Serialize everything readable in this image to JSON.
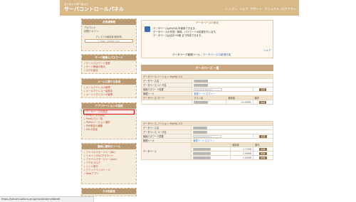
{
  "header": {
    "logo_sub": "さくらインターネット",
    "logo_main": "サーバコントロールパネル",
    "nav": [
      "トップへ",
      "ヘルプ",
      "サポート",
      "マニュアル",
      "ログアウト"
    ]
  },
  "sidebar": {
    "account": {
      "title": "お客様情報",
      "rows": [
        "アカウント",
        "初期ドメイン"
      ],
      "disk_label": "ディスクの使用量(使用率)",
      "disk_value": "1.9GB / 300GB (1%)"
    },
    "server_settings": {
      "title": "サーバ情報とパスワード",
      "items": [
        "サーバパスワード変更",
        "サーバ情報の表示",
        "ログの設定"
      ]
    },
    "mail_settings": {
      "title": "メールに関する設定",
      "items": [
        "メールアドレスの管理",
        "メールアドレス一括設定",
        "メーリングリストの管理"
      ]
    },
    "app_settings": {
      "title": "アプリケーションの設定",
      "items": [
        "データベースの設定",
        "CGIのパスの設定",
        "Perlのパス一覧",
        "PHPのバージョン選択",
        "PHP設定の編集",
        "SSLの設定"
      ]
    },
    "tools": {
      "title": "運用に便利なツール",
      "items": [
        "ファイルマネージャー(ftp)",
        "ドメイン/SSL/アカウント",
        "ファイルマネージャー(root)",
        "アクセスログ",
        "シェル実行",
        "クイックインストール",
        "Webアプリ"
      ]
    },
    "other": {
      "title": "その他設定"
    }
  },
  "main": {
    "top_box": {
      "title": "データベースの設定",
      "body_lines": [
        "データベースはMySQLを使用できます。",
        "データベースの作成・削除、パスワードの変更を行います。",
        "データベースは合計 50個 まで作成できます。"
      ],
      "help": "ヘルプ",
      "link_main": "データベース管理ツール",
      "link_sub": "データベースの新規作成"
    },
    "list_title": "データベース 一覧",
    "db1": {
      "server_row": "データベース バージョン: MySQL 5.5",
      "rows": [
        {
          "label": "データベース名",
          "value": "████████"
        },
        {
          "label": "データベース ユーザ名",
          "value": "████████"
        },
        {
          "label": "接続パスワード変更",
          "value": "••••••••••••••"
        }
      ],
      "tool_label": "管理ツール",
      "tool_link": "管理ツール ログイン",
      "col_headers": [
        "データベース サーバ",
        "ホスト名",
        "使用量",
        "操作"
      ],
      "host_row": {
        "server": "████████",
        "usage": "29.99MB",
        "btn": "削除"
      },
      "pw_btn": "変更"
    },
    "db2": {
      "server_row": "データベース バージョン: MySQL 5.5",
      "rows": [
        {
          "label": "データベース名",
          "value": "████████"
        },
        {
          "label": "データベース ユーザ名",
          "value": "████████"
        },
        {
          "label": "接続パスワード変更",
          "value": "••••••••••••••"
        }
      ],
      "tool_label": "管理ツール",
      "tool_link": "管理ツール ログイン",
      "col_headers": [
        "データベース",
        "使用量",
        "操作"
      ],
      "host_rows": [
        {
          "name": "██████████",
          "usage": "2.77MB",
          "btn": "削除"
        },
        {
          "name": "██████████",
          "usage": "2.90MB",
          "btn": "削除"
        },
        {
          "name": "██████████",
          "usage": "3.80MB",
          "btn": "削除"
        }
      ],
      "pw_btn": "変更"
    }
  },
  "status_bar": {
    "url": "https://secure.sakura.ad.jp/rscontrol/rs/dbedit"
  }
}
